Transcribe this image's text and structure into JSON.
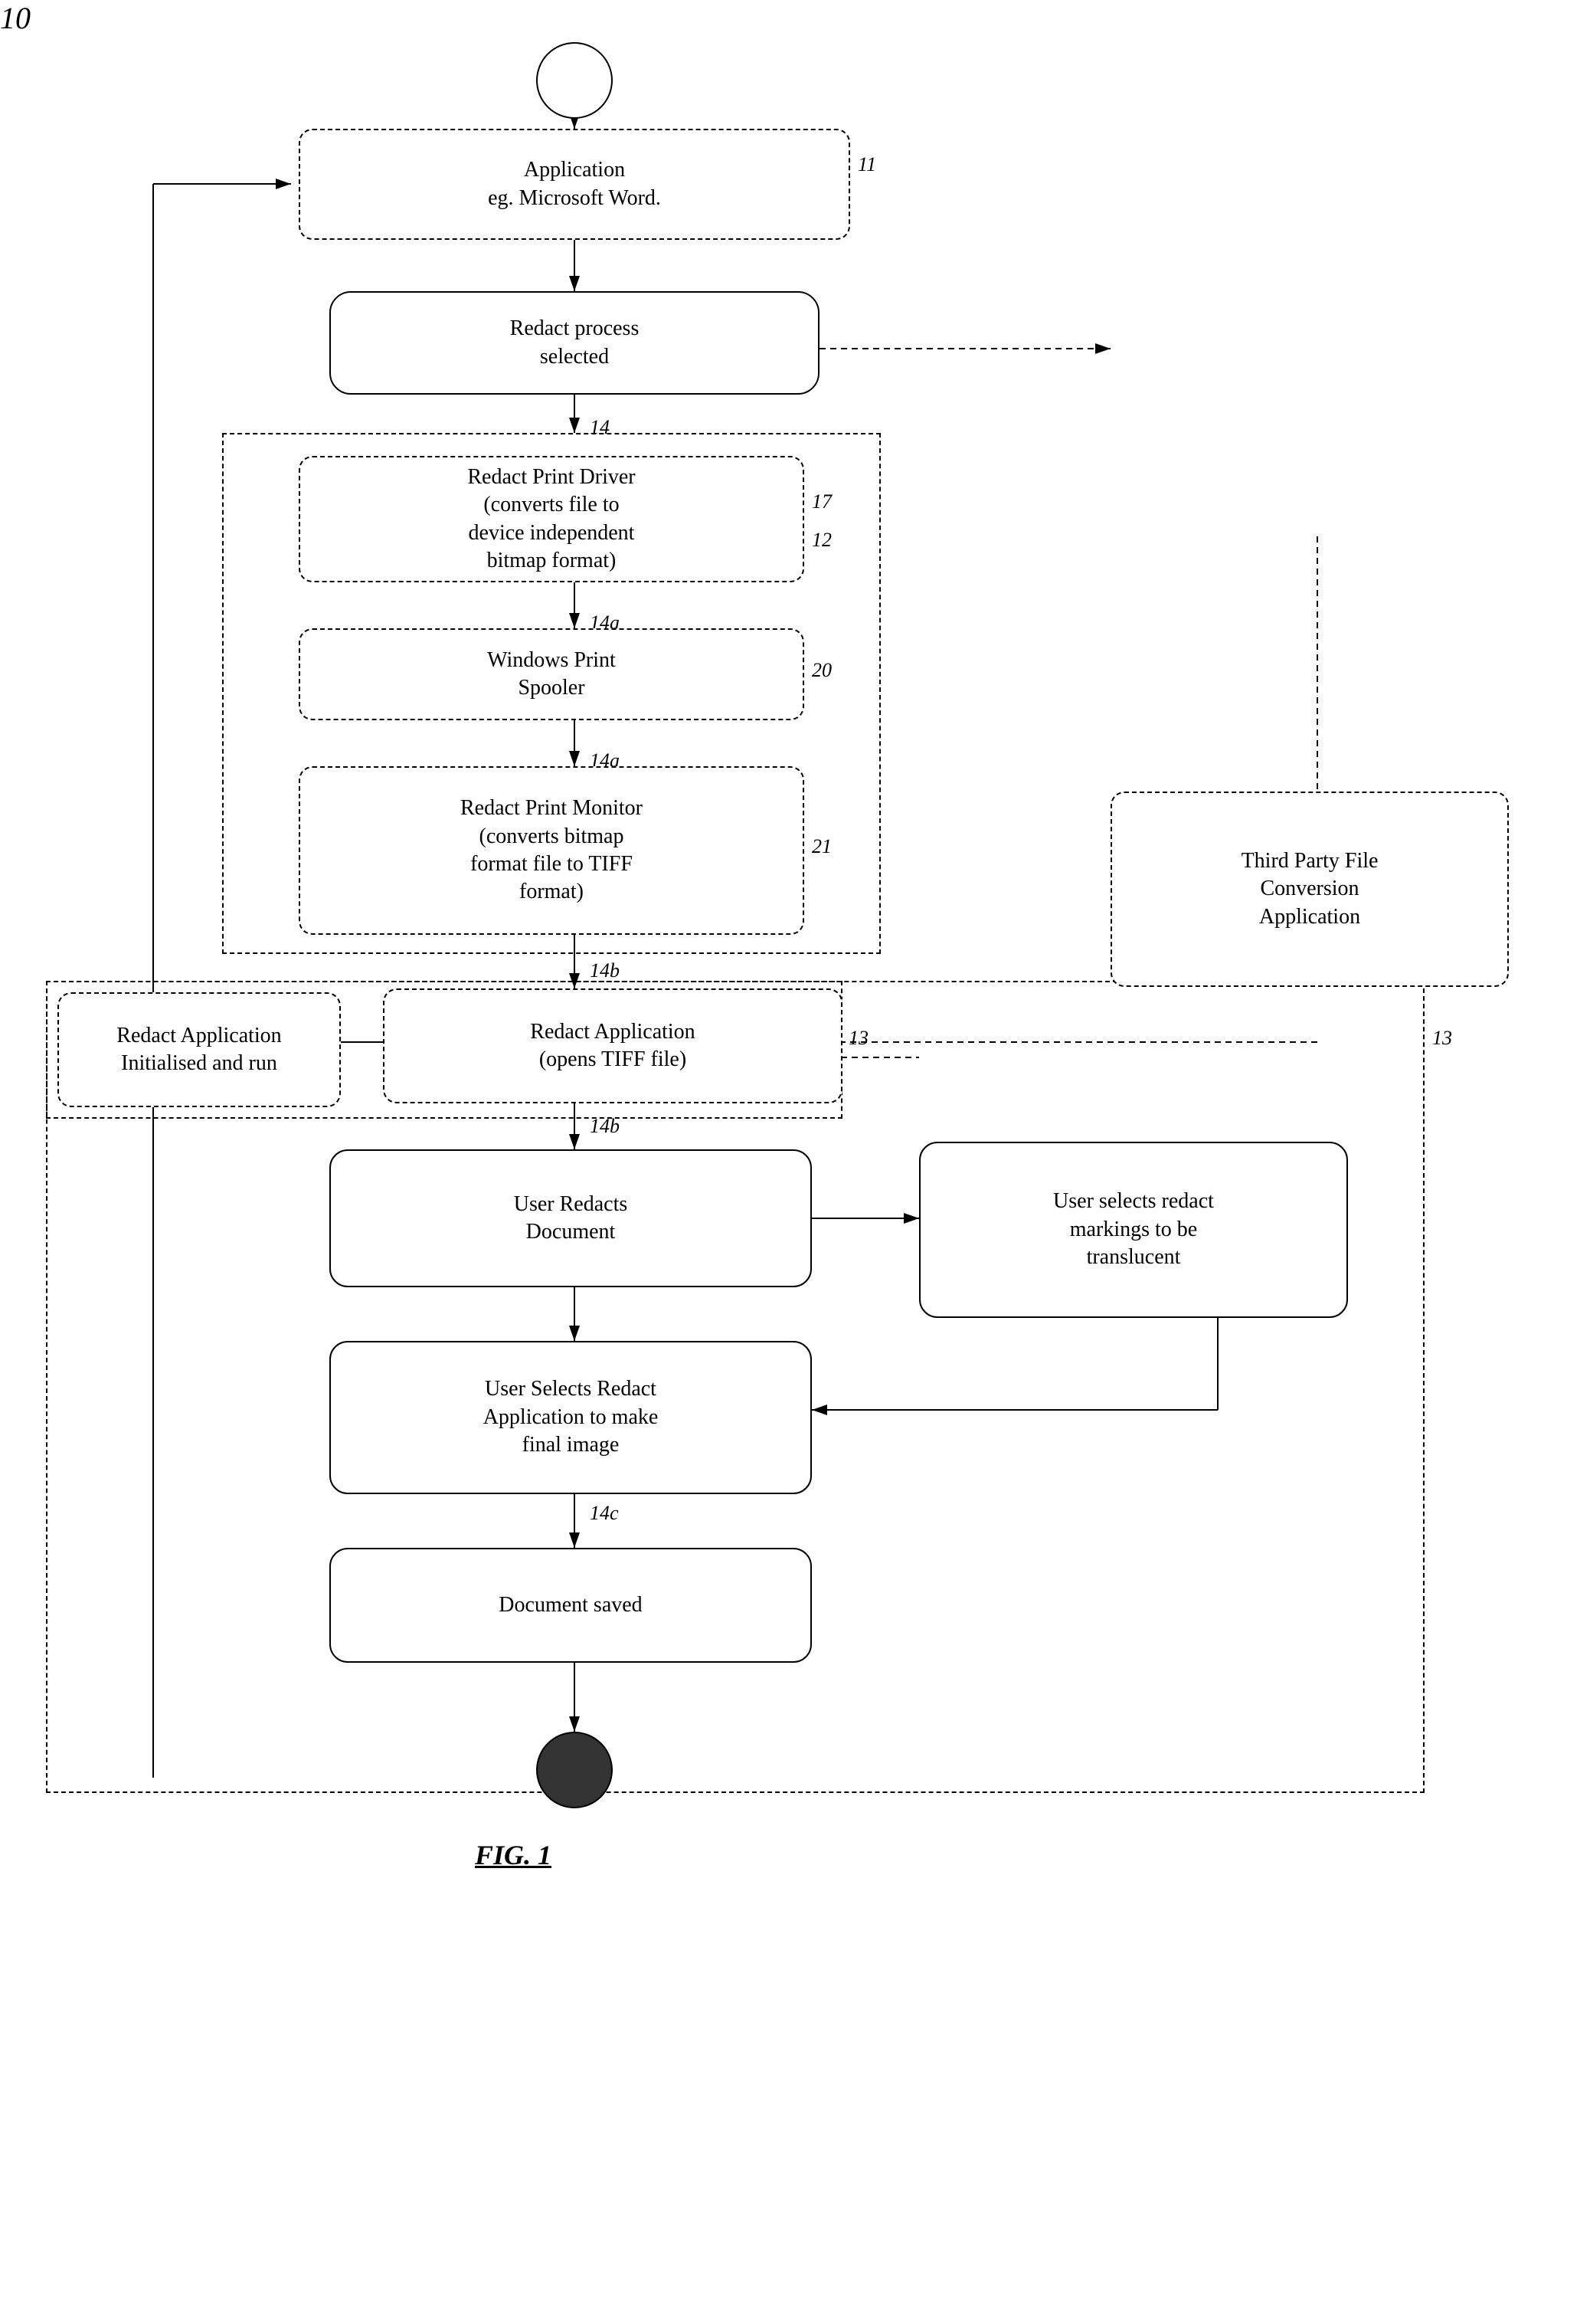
{
  "title": "FIG. 1",
  "nodes": {
    "start_circle": {
      "label": ""
    },
    "application": {
      "label": "Application\neg. Microsoft Word."
    },
    "redact_process": {
      "label": "Redact process\nselected"
    },
    "redact_print_driver": {
      "label": "Redact Print Driver\n(converts file to\ndevice independent\nbitmap format)"
    },
    "windows_print_spooler": {
      "label": "Windows Print\nSpooler"
    },
    "redact_print_monitor": {
      "label": "Redact Print Monitor\n(converts bitmap\nformat file to TIFF\nformat)"
    },
    "redact_app_init": {
      "label": "Redact Application\nInitialised and run"
    },
    "redact_application": {
      "label": "Redact Application\n(opens TIFF file)"
    },
    "user_redacts": {
      "label": "User Redacts\nDocument"
    },
    "user_selects_translucent": {
      "label": "User selects redact\nmarkings to be\ntranslucent"
    },
    "user_selects_final": {
      "label": "User Selects Redact\nApplication to make\nfinal image"
    },
    "document_saved": {
      "label": "Document saved"
    },
    "third_party": {
      "label": "Third Party File\nConversion\nApplication"
    },
    "end_circle": {
      "label": ""
    }
  },
  "labels": {
    "n10": "10",
    "n11": "11",
    "n12": "12",
    "n13a": "13",
    "n13b": "13",
    "n14": "14",
    "n14a1": "14a",
    "n14a2": "14a",
    "n14b1": "14b",
    "n14b2": "14b",
    "n14c": "14c",
    "n17": "17",
    "n20": "20",
    "n21": "21",
    "fig": "FIG. 1"
  }
}
